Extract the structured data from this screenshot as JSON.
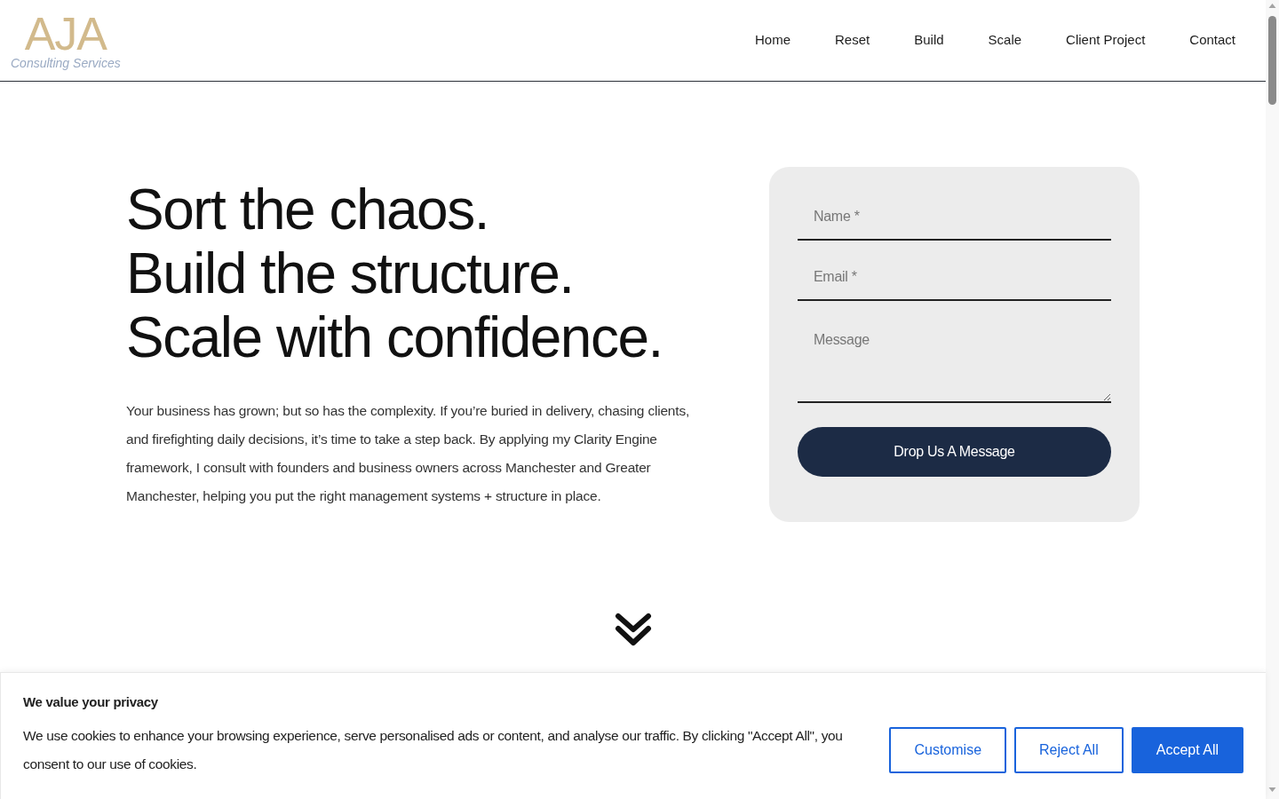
{
  "header": {
    "logo": {
      "mark": "AJA",
      "tagline": "Consulting Services"
    },
    "nav": [
      {
        "label": "Home"
      },
      {
        "label": "Reset"
      },
      {
        "label": "Build"
      },
      {
        "label": "Scale"
      },
      {
        "label": "Client Project"
      },
      {
        "label": "Contact"
      }
    ]
  },
  "hero": {
    "heading": [
      "Sort the chaos.",
      "Build the structure.",
      "Scale with confidence."
    ],
    "body": "Your business has grown; but so has the complexity. If you’re buried in delivery, chasing clients, and firefighting daily decisions, it’s time to take a step back. By applying my Clarity Engine framework, I consult with founders and business owners across Manchester and Greater Manchester, helping you put the right management systems + structure in place."
  },
  "contact_form": {
    "fields": [
      {
        "kind": "input",
        "placeholder": "Name *"
      },
      {
        "kind": "input",
        "placeholder": "Email *"
      },
      {
        "kind": "textarea",
        "placeholder": "Message"
      }
    ],
    "submit": "Drop Us A Message"
  },
  "cookie_banner": {
    "title": "We value your privacy",
    "text": "We use cookies to enhance your browsing experience, serve personalised ads or content, and analyse our traffic. By clicking \"Accept All\", you consent to our use of cookies.",
    "buttons": [
      {
        "label": "Customise",
        "kind": "outline"
      },
      {
        "label": "Reject All",
        "kind": "outline"
      },
      {
        "label": "Accept All",
        "kind": "primary"
      }
    ]
  }
}
